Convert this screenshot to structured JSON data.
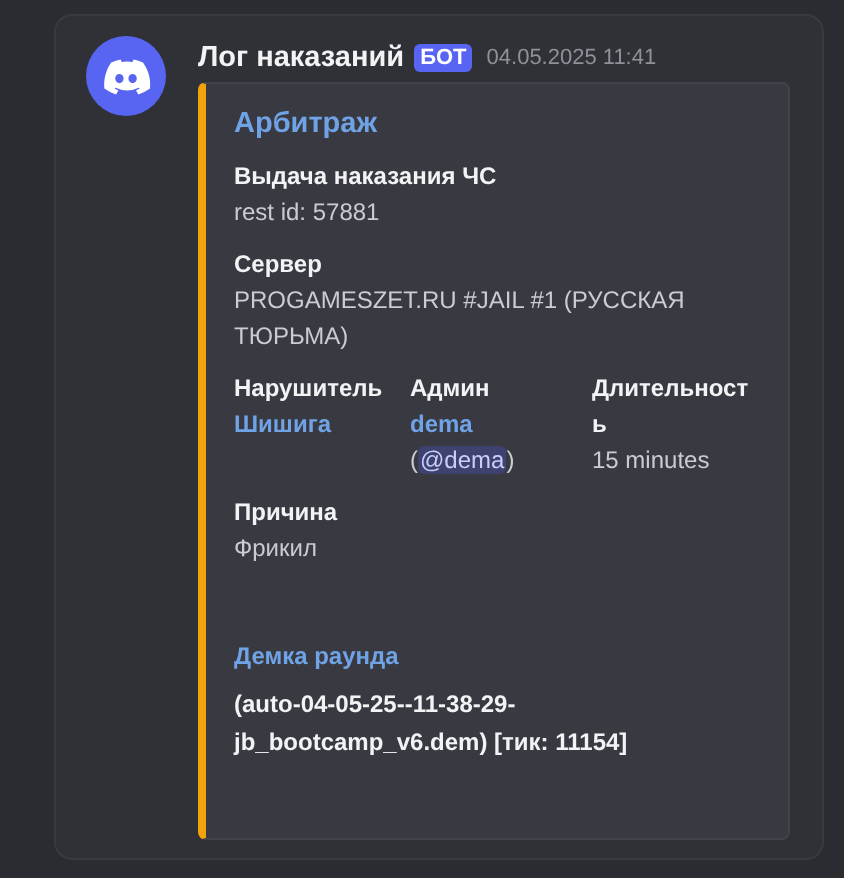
{
  "message": {
    "author": "Лог наказаний",
    "badge": "БОТ",
    "timestamp": "04.05.2025 11:41"
  },
  "embed": {
    "title": "Арбитраж",
    "fields": [
      {
        "kind": "full",
        "name": "Выдача наказания ЧС",
        "value": "rest id: 57881"
      },
      {
        "kind": "full",
        "name": "Сервер",
        "value": "PROGAMESZET.RU #JAIL #1 (РУССКАЯ ТЮРЬМА)"
      }
    ],
    "inline_fields": [
      {
        "kind": "link",
        "name": "Нарушитель",
        "value": "Шишига"
      },
      {
        "kind": "mention",
        "name": "Админ",
        "value": "dema",
        "open": "(",
        "mention": "@dema",
        "close": ")"
      },
      {
        "kind": "plain",
        "name": "Длительность",
        "value": "15 minutes"
      }
    ],
    "reason": {
      "name": "Причина",
      "value": "Фрикил"
    },
    "demo": {
      "name": "Демка раунда",
      "value": "(auto-04-05-25--11-38-29-jb_bootcamp_v6.dem) [тик: 11154]"
    }
  }
}
